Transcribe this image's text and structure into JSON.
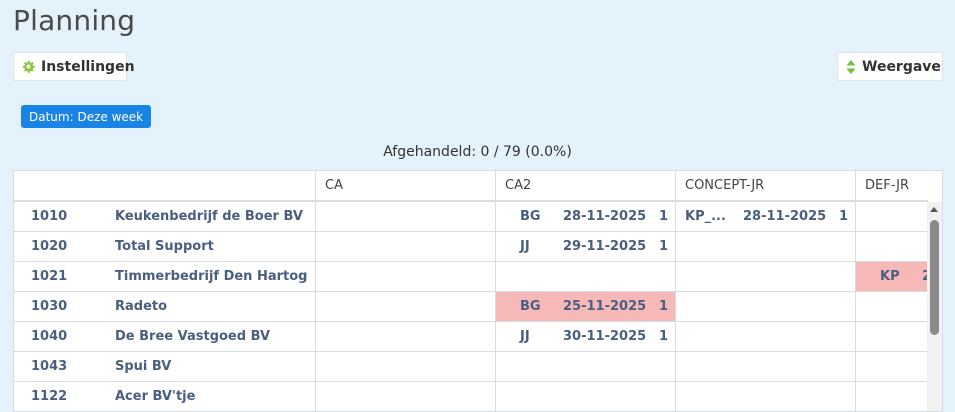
{
  "page": {
    "title": "Planning"
  },
  "toolbar": {
    "settings_label": "Instellingen",
    "settings_icon": "gear-icon",
    "view_label": "Weergave",
    "view_icon": "sort-arrows-icon"
  },
  "filter": {
    "date_badge": "Datum: Deze week"
  },
  "progress": {
    "text": "Afgehandeld: 0 / 79 (0.0%)"
  },
  "grid": {
    "columns": [
      "CA",
      "CA2",
      "CONCEPT-JR",
      "DEF-JR"
    ],
    "rows": [
      {
        "code": "1010",
        "name": "Keukenbedrijf de Boer BV",
        "ca2": {
          "who": "BG",
          "date": "28-11-2025",
          "count": "1",
          "highlight": false
        },
        "concept": {
          "who": "KP_...",
          "date": "28-11-2025",
          "count": "1",
          "highlight": false
        },
        "def": null
      },
      {
        "code": "1020",
        "name": "Total Support",
        "ca2": {
          "who": "JJ",
          "date": "29-11-2025",
          "count": "1",
          "highlight": false
        },
        "concept": null,
        "def": null
      },
      {
        "code": "1021",
        "name": "Timmerbedrijf Den Hartog",
        "ca2": null,
        "concept": null,
        "def": {
          "who": "KP",
          "date": "2",
          "highlight": true
        }
      },
      {
        "code": "1030",
        "name": "Radeto",
        "ca2": {
          "who": "BG",
          "date": "25-11-2025",
          "count": "1",
          "highlight": true
        },
        "concept": null,
        "def": null
      },
      {
        "code": "1040",
        "name": "De Bree Vastgoed BV",
        "ca2": {
          "who": "JJ",
          "date": "30-11-2025",
          "count": "1",
          "highlight": false
        },
        "concept": null,
        "def": null
      },
      {
        "code": "1043",
        "name": "Spui BV",
        "ca2": null,
        "concept": null,
        "def": null
      },
      {
        "code": "1122",
        "name": "Acer BV'tje",
        "ca2": null,
        "concept": null,
        "def": null
      }
    ]
  },
  "colors": {
    "background": "#e3f2fb",
    "accent": "#1a84e6",
    "highlight": "#f7b8b8",
    "text_link": "#4a5f80",
    "gear_icon": "#8cc63f",
    "view_icon": "#6cbf3a"
  }
}
